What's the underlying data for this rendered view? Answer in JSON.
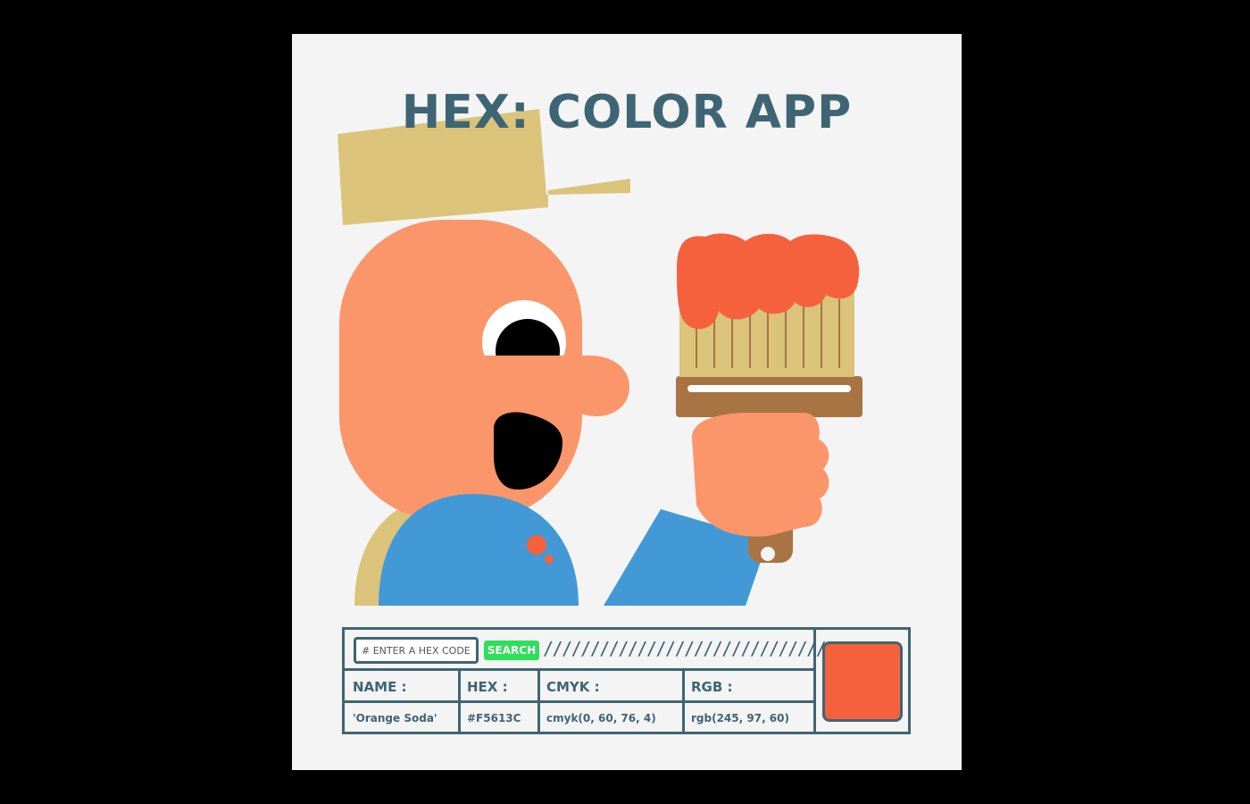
{
  "app": {
    "title": "HEX: COLOR APP"
  },
  "search": {
    "placeholder": "# ENTER A HEX CODE",
    "value": "",
    "button_label": "SEARCH",
    "divider_pattern": "//////////////////////////////"
  },
  "details": {
    "headers": {
      "name": "NAME :",
      "hex": "HEX :",
      "cmyk": "CMYK :",
      "rgb": "RGB :"
    },
    "values": {
      "name": "'Orange Soda'",
      "hex": "#F5613C",
      "cmyk": "cmyk(0, 60, 76, 4)",
      "rgb": "rgb(245, 97, 60)"
    }
  },
  "swatch": {
    "color": "#F5613C"
  },
  "illustration": {
    "subject": "painter-holding-paintbrush",
    "colors": {
      "cap": "#dbc37a",
      "skin": "#fb956a",
      "shirt": "#4299d6",
      "brush_handle": "#a97443",
      "bristles": "#dbc37a",
      "paint": "#f5613c"
    }
  },
  "theme": {
    "accent": "#3e6574",
    "search_button": "#2de05a",
    "background": "#f4f4f4"
  }
}
